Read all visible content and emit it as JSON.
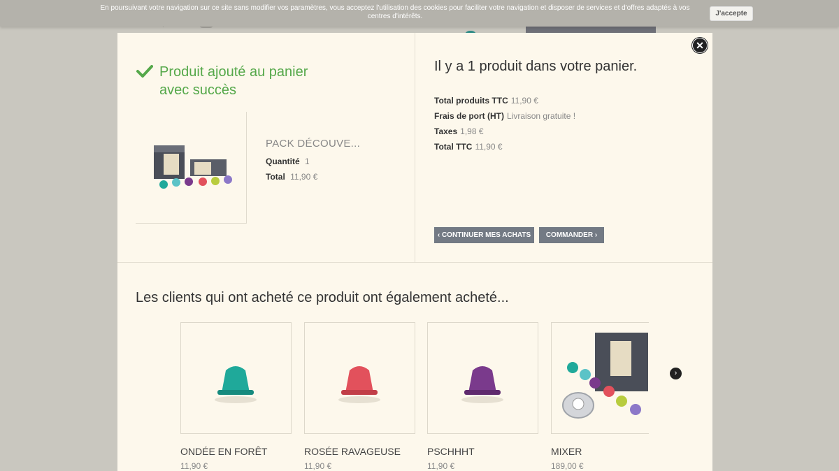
{
  "background": {
    "price": "189,00 €"
  },
  "cookie": {
    "text": "En poursuivant votre navigation sur ce site sans modifier vos paramètres, vous acceptez l'utilisation des cookies pour faciliter votre navigation et disposer de services et d'offres adaptés à vos centres d'intérêts.",
    "accept_label": "J'accepte"
  },
  "modal": {
    "close_icon": "close-icon",
    "success_message": "Produit ajouté au panier avec succès",
    "product": {
      "name": "PACK DÉCOUVE...",
      "quantity_label": "Quantité",
      "quantity_value": "1",
      "total_label": "Total",
      "total_value": "11,90 €"
    },
    "cart": {
      "heading": "Il y a 1 produit dans votre panier.",
      "rows": [
        {
          "label": "Total produits TTC",
          "value": "11,90 €"
        },
        {
          "label": "Frais de port (HT)",
          "value": "Livraison gratuite !"
        },
        {
          "label": "Taxes",
          "value": "1,98 €"
        },
        {
          "label": "Total TTC",
          "value": "11,90 €"
        }
      ]
    },
    "buttons": {
      "continue_label": "CONTINUER MES ACHATS",
      "order_label": "COMMANDER"
    },
    "also_bought": {
      "heading": "Les clients qui ont acheté ce produit ont également acheté...",
      "items": [
        {
          "name": "ONDÉE EN FORÊT",
          "price": "11,90 €",
          "color": "#1fa99a"
        },
        {
          "name": "ROSÉE RAVAGEUSE",
          "price": "11,90 €",
          "color": "#e2515c"
        },
        {
          "name": "PSCHHHT",
          "price": "11,90 €",
          "color": "#7a3a8c"
        },
        {
          "name": "MIXER",
          "price": "189,00 €",
          "color": "#8a8fa0"
        }
      ]
    }
  },
  "colors": {
    "success": "#55a84a",
    "button": "#737a84",
    "modal_bg": "#fdf8ec"
  }
}
